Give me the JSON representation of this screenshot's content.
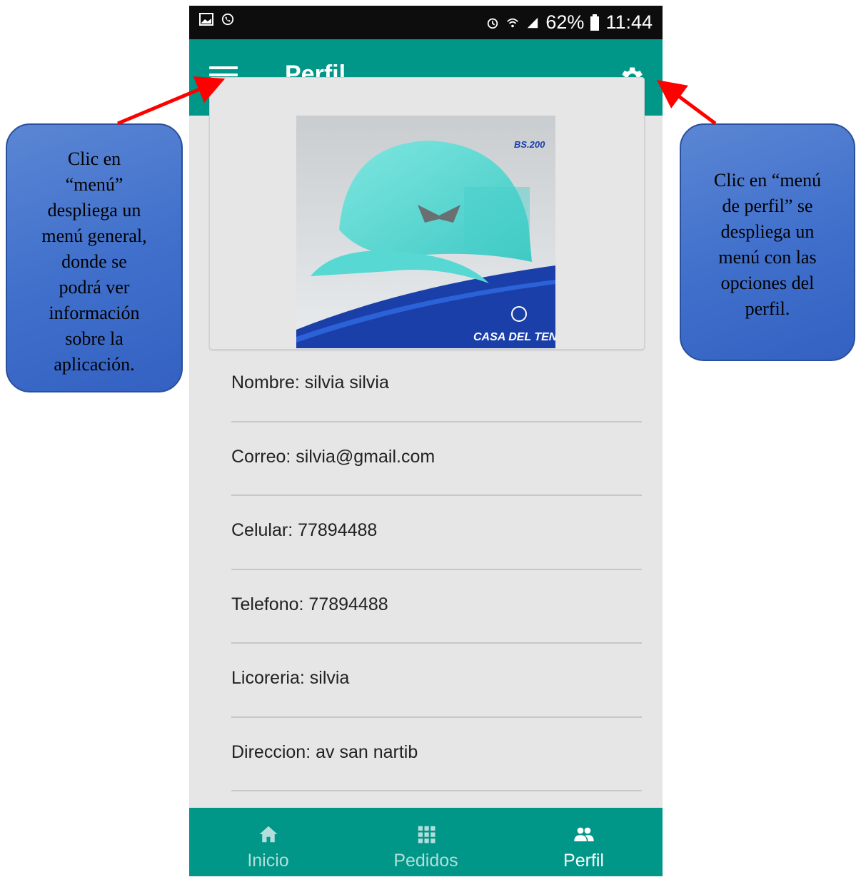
{
  "statusbar": {
    "battery": "62%",
    "time": "11:44"
  },
  "appbar": {
    "title": "Perfil"
  },
  "product": {
    "price": "BS.200",
    "brand": "CASA DEL TENIS"
  },
  "profile_fields": [
    "Nombre: silvia silvia",
    "Correo: silvia@gmail.com",
    "Celular: 77894488",
    "Telefono: 77894488",
    "Licoreria: silvia",
    "Direccion: av san nartib"
  ],
  "bottom_nav": [
    {
      "label": "Inicio",
      "icon": "home-icon",
      "active": false
    },
    {
      "label": "Pedidos",
      "icon": "grid-icon",
      "active": false
    },
    {
      "label": "Perfil",
      "icon": "people-icon",
      "active": true
    }
  ],
  "callouts": {
    "left": [
      "Clic en",
      "“menú”",
      "despliega un",
      "menú general,",
      "donde se",
      "podrá ver",
      "información",
      "sobre la",
      "aplicación."
    ],
    "right": [
      "Clic en “menú",
      "de perfil” se",
      "despliega un",
      "menú con las",
      "opciones del",
      "perfil."
    ]
  },
  "colors": {
    "appbar": "#009688",
    "statusbar": "#0d0d0d",
    "background": "#e6e6e6",
    "callout": "#4472c4",
    "arrow": "#ff0000"
  }
}
